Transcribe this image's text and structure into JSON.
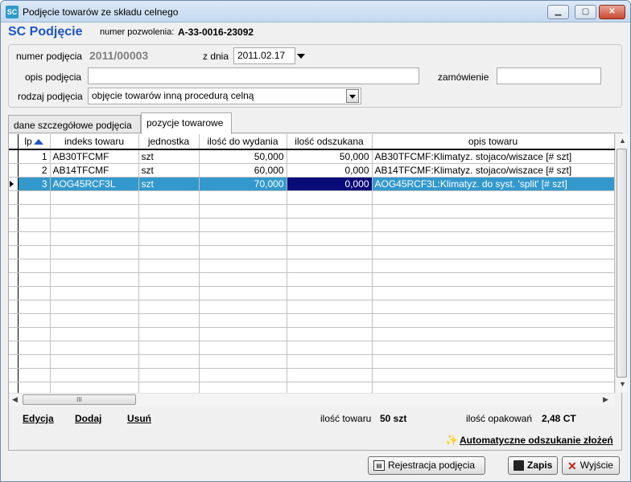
{
  "window": {
    "title": "Podjęcie towarów ze składu celnego",
    "icon_text": "SC",
    "controls": [
      "minimize-icon",
      "maximize-icon",
      "close-icon"
    ]
  },
  "header": {
    "title": "SC Podjęcie",
    "permit_label": "numer pozwolenia:",
    "permit_value": "A-33-0016-23092"
  },
  "form": {
    "number_label": "numer podjęcia",
    "number_value": "2011/00003",
    "date_label": "z dnia",
    "date_value": "2011.02.17",
    "description_label": "opis podjęcia",
    "description_value": "",
    "order_label": "zamówienie",
    "order_value": "",
    "type_label": "rodzaj podjęcia",
    "type_value": "objęcie towarów inną procedurą celną"
  },
  "tabs": [
    {
      "label": "dane szczegółowe podjęcia",
      "active": false
    },
    {
      "label": "pozycje towarowe",
      "active": true
    }
  ],
  "grid": {
    "columns": [
      "lp",
      "indeks towaru",
      "jednostka",
      "ilość do wydania",
      "ilość odszukana",
      "opis towaru"
    ],
    "rows": [
      {
        "lp": "1",
        "index": "AB30TFCMF",
        "unit": "szt",
        "qty": "50,000",
        "found": "50,000",
        "desc": "AB30TFCMF:Klimatyz. stojaco/wiszace [# szt]"
      },
      {
        "lp": "2",
        "index": "AB14TFCMF",
        "unit": "szt",
        "qty": "60,000",
        "found": "0,000",
        "desc": "AB14TFCMF:Klimatyz. stojaco/wiszace [# szt]"
      },
      {
        "lp": "3",
        "index": "AOG45RCF3L",
        "unit": "szt",
        "qty": "70,000",
        "found": "0,000",
        "desc": "AOG45RCF3L:Klimatyz. do syst. 'split' [# szt]"
      }
    ],
    "selected_row": 3
  },
  "actions": {
    "edit": "Edycja",
    "add": "Dodaj",
    "remove": "Usuń"
  },
  "summary": {
    "qty_label": "ilość towaru",
    "qty_value": "50 szt",
    "pack_label": "ilość opakowań",
    "pack_value": "2,48 CT"
  },
  "auto_find": "Automatyczne odszukanie złożeń",
  "buttons": {
    "register": "Rejestracja podjęcia",
    "save": "Zapis",
    "exit": "Wyjście"
  },
  "colors": {
    "title_blue": "#1d56c7",
    "selection": "#3399cc",
    "selection_dark": "#0a0a78"
  }
}
